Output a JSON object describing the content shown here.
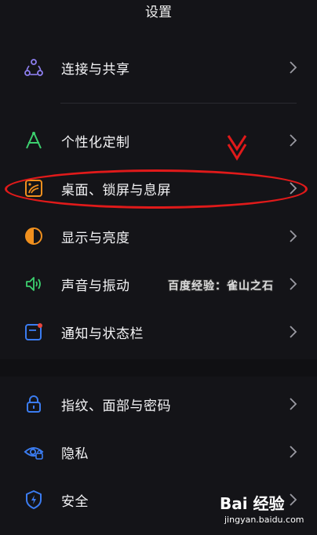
{
  "header": {
    "title": "设置"
  },
  "rows": [
    {
      "label": "连接与共享",
      "icon": "share-nodes-icon"
    },
    {
      "label": "个性化定制",
      "icon": "compass-icon"
    },
    {
      "label": "桌面、锁屏与息屏",
      "icon": "wallpaper-icon"
    },
    {
      "label": "显示与亮度",
      "icon": "contrast-icon"
    },
    {
      "label": "声音与振动",
      "icon": "speaker-icon"
    },
    {
      "label": "通知与状态栏",
      "icon": "notification-icon"
    },
    {
      "label": "指纹、面部与密码",
      "icon": "lock-icon"
    },
    {
      "label": "隐私",
      "icon": "privacy-eye-icon"
    },
    {
      "label": "安全",
      "icon": "shield-icon"
    }
  ],
  "watermark": {
    "text": "百度经验：雀山之石"
  },
  "logo": {
    "brand": "Bai 经验",
    "url": "jingyan.baidu.com"
  },
  "colors": {
    "background": "#141418",
    "annotation": "#e01a1a",
    "icon_purple": "#8e7ff0",
    "icon_green": "#3ccf6e",
    "icon_orange": "#f0901e",
    "icon_red": "#e8453c",
    "icon_blue": "#3b7cf0"
  }
}
